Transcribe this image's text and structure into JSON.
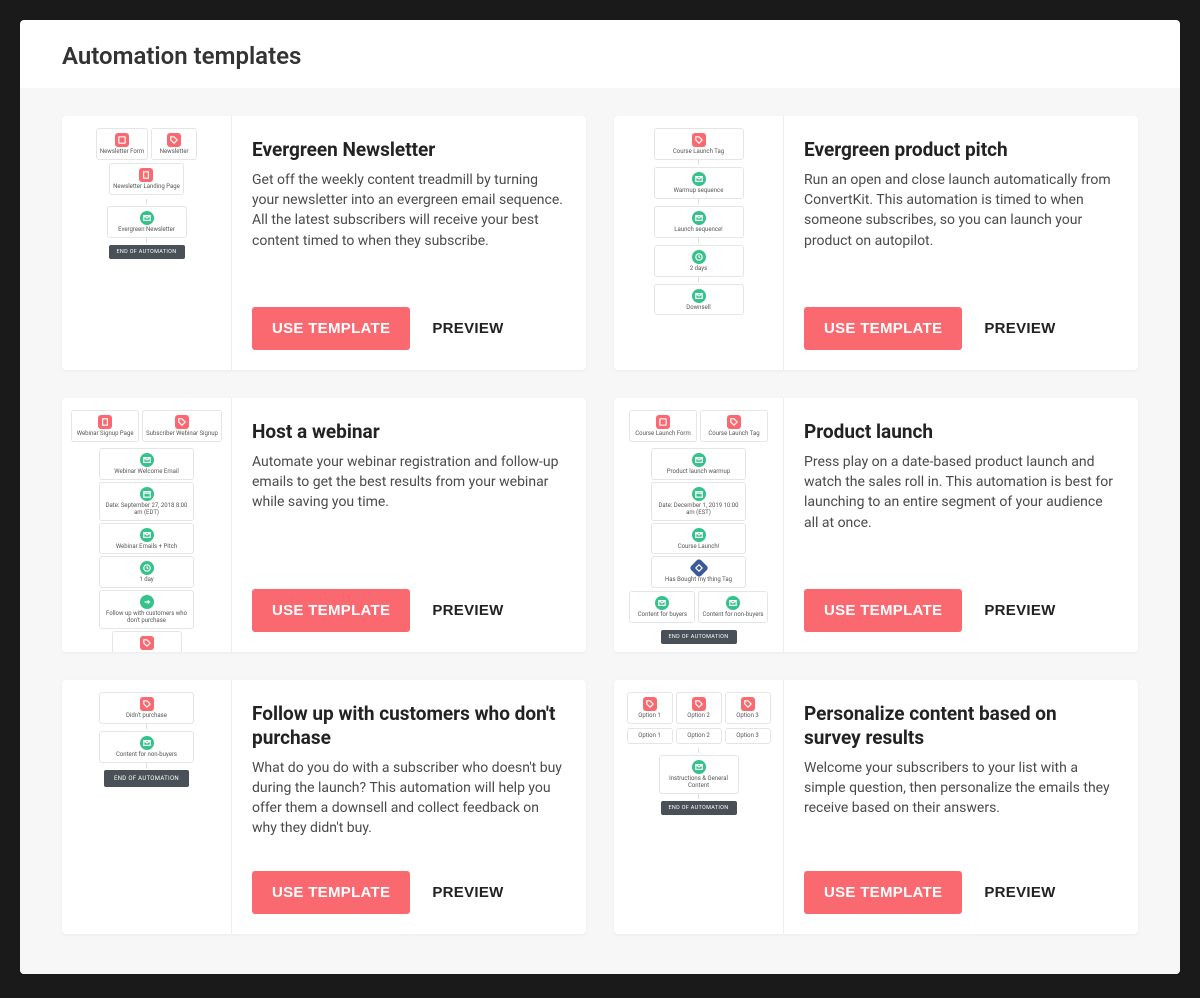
{
  "header": {
    "title": "Automation templates"
  },
  "buttons": {
    "use_template": "USE TEMPLATE",
    "preview": "PREVIEW"
  },
  "templates": [
    {
      "title": "Evergreen Newsletter",
      "desc": "Get off the weekly content treadmill by turning your newsletter into an evergreen email sequence. All the latest subscribers will receive your best content timed to when they subscribe.",
      "thumb_nodes": {
        "row1": [
          "Newsletter Form",
          "Newsletter",
          "Newsletter Landing Page"
        ],
        "node2": "Evergreen Newsletter",
        "end": "END OF AUTOMATION"
      }
    },
    {
      "title": "Evergreen product pitch",
      "desc": "Run an open and close launch automatically from ConvertKit. This automation is timed to when someone subscribes, so you can launch your product on autopilot.",
      "thumb_nodes": {
        "n1": "Course Launch Tag",
        "n2": "Warmup sequence",
        "n3": "Launch sequence!",
        "n4": "2 days",
        "n5": "Downsell"
      }
    },
    {
      "title": "Host a webinar",
      "desc": "Automate your webinar registration and follow-up emails to get the best results from your webinar while saving you time.",
      "thumb_nodes": {
        "row1": [
          "Webinar Signup Page",
          "Subscriber Webinar Signup"
        ],
        "n2": "Webinar Welcome Email",
        "n3": "Date: September 27, 2018 8:00 am (EDT)",
        "n4": "Webinar Emails + Pitch",
        "n5": "1 day",
        "n6": "Follow up with customers who don't purchase"
      }
    },
    {
      "title": "Product launch",
      "desc": "Press play on a date-based product launch and watch the sales roll in. This automation is best for launching to an entire segment of your audience all at once.",
      "thumb_nodes": {
        "row1": [
          "Course Launch Form",
          "Course Launch Tag"
        ],
        "n2": "Product launch warmup",
        "n3": "Date: December 1, 2019 10:00 am (EST)",
        "n4": "Course Launch!",
        "n5": "Has Bought my thing Tag",
        "row6": [
          "Content for buyers",
          "Content for non-buyers"
        ],
        "end": "END OF AUTOMATION"
      }
    },
    {
      "title": "Follow up with customers who don't purchase",
      "desc": "What do you do with a subscriber who doesn't buy during the launch? This automation will help you offer them a downsell and collect feedback on why they didn't buy.",
      "thumb_nodes": {
        "n1": "Didn't purchase",
        "n2": "Content for non-buyers",
        "end": "END OF AUTOMATION"
      }
    },
    {
      "title": "Personalize content based on survey results",
      "desc": "Welcome your subscribers to your list with a simple question, then personalize the emails they receive based on their answers.",
      "thumb_nodes": {
        "row1": [
          "Option 1",
          "Option 2",
          "Option 3"
        ],
        "row2": [
          "Option 1",
          "Option 2",
          "Option 3"
        ],
        "n3": "Instructions & General Content",
        "end": "END OF AUTOMATION"
      }
    }
  ]
}
